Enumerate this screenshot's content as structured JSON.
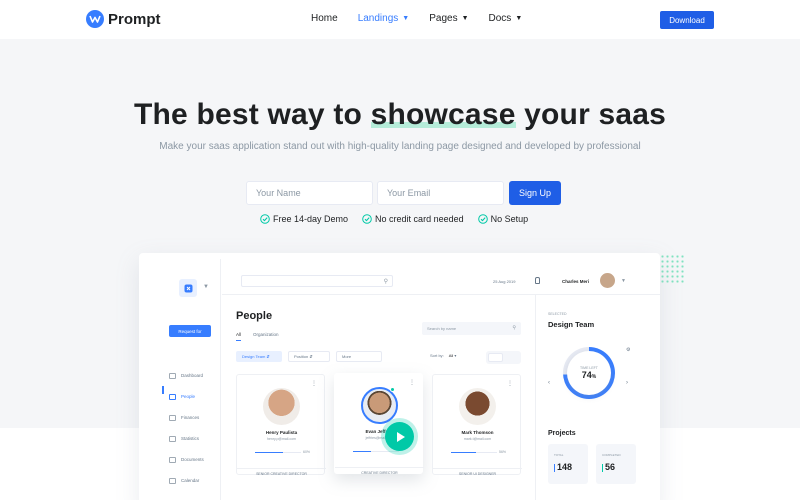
{
  "navbar": {
    "brand": "Prompt",
    "links": [
      {
        "label": "Home",
        "active": false,
        "dropdown": false
      },
      {
        "label": "Landings",
        "active": true,
        "dropdown": true
      },
      {
        "label": "Pages",
        "active": false,
        "dropdown": true
      },
      {
        "label": "Docs",
        "active": false,
        "dropdown": true
      }
    ],
    "download_label": "Download"
  },
  "hero": {
    "title_before": "The best way to ",
    "title_highlight": "showcase",
    "title_after": " your saas",
    "subtitle": "Make your saas application stand out with high-quality landing page designed and developed by professional",
    "name_placeholder": "Your Name",
    "email_placeholder": "Your Email",
    "signup_label": "Sign Up",
    "checks": [
      "Free 14-day Demo",
      "No credit card needed",
      "No Setup"
    ]
  },
  "mock": {
    "sidebar": {
      "request_label": "Request for",
      "items": [
        "Dashboard",
        "People",
        "Finances",
        "Statistics",
        "Documents",
        "Calendar"
      ],
      "active_index": 1
    },
    "topbar": {
      "date": "25 Aug 2019",
      "user": "Charles Meri"
    },
    "main": {
      "title": "People",
      "tabs": [
        "All",
        "Organization"
      ],
      "search_placeholder": "Search by name",
      "filters": [
        "Design Team",
        "Position",
        "More"
      ],
      "sort_label": "Sort by:",
      "sort_value": "All",
      "cards": [
        {
          "name": "Henry Paulista",
          "email": "henry.p@mail.com",
          "progress": 0.6,
          "pct": "60%",
          "role": "SENIOR CREATIVE DIRECTOR"
        },
        {
          "name": "Evan Jeffries",
          "email": "jeffries@mail.com",
          "progress": 0.4,
          "pct": "",
          "role": "CREATIVE DIRECTOR"
        },
        {
          "name": "Mark Thomson",
          "email": "mark.t@mail.com",
          "progress": 0.55,
          "pct": "56%",
          "role": "SENIOR UI DESIGNER"
        }
      ]
    },
    "right": {
      "selected_label": "SELECTED",
      "team": "Design Team",
      "ring_label": "TIME LEFT",
      "ring_value": "74",
      "ring_unit": "%",
      "projects_title": "Projects",
      "stats": [
        {
          "label": "TOTAL",
          "value": "148",
          "color": "#377dff"
        },
        {
          "label": "COMPLETED",
          "value": "56",
          "color": "#00c9a7"
        }
      ]
    }
  },
  "colors": {
    "accent": "#377dff",
    "button": "#1f5ee6",
    "success": "#00c9a7",
    "highlight": "#7fe3c0"
  }
}
